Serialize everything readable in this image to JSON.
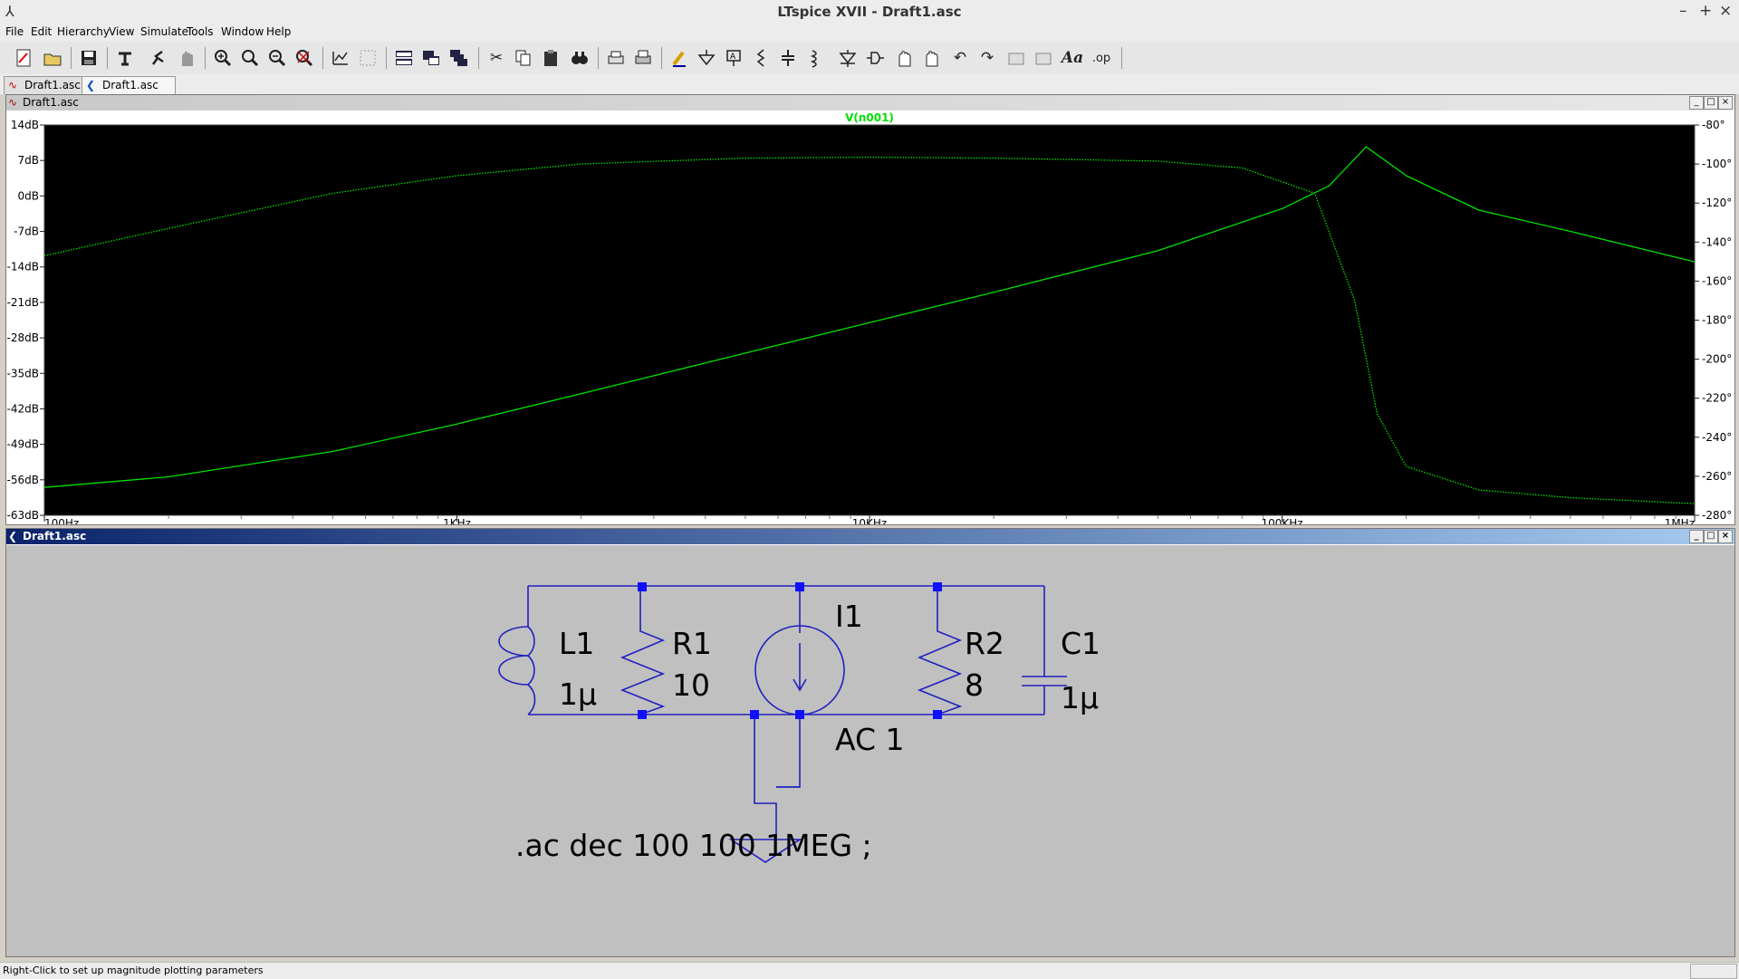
{
  "window": {
    "title": "LTspice XVII - Draft1.asc",
    "minimize": "–",
    "maximize": "+",
    "close": "×"
  },
  "menu": [
    "File",
    "Edit",
    "Hierarchy",
    "View",
    "Simulate",
    "Tools",
    "Window",
    "Help"
  ],
  "toolbar_icons": [
    "new-schematic-icon",
    "open-icon",
    "save-icon",
    "control-panel-icon",
    "run-icon",
    "halt-icon",
    "zoom-in-icon",
    "zoom-area-icon",
    "zoom-out-icon",
    "zoom-fit-icon",
    "autorange-icon",
    "plot-settings-icon",
    "tile-horizontal-icon",
    "tile-vertical-icon",
    "cascade-icon",
    "cut-icon",
    "copy-icon",
    "paste-icon",
    "find-icon",
    "print-icon",
    "print-setup-icon",
    "wire-icon",
    "ground-icon",
    "label-net-icon",
    "resistor-icon",
    "capacitor-icon",
    "inductor-icon",
    "diode-icon",
    "component-icon",
    "move-icon",
    "drag-icon",
    "undo-icon",
    "redo-icon",
    "rotate-icon",
    "mirror-icon",
    "text-icon",
    "spice-directive-icon"
  ],
  "tabs": [
    {
      "label": "Draft1.asc",
      "icon": "waveform-icon"
    },
    {
      "label": "Draft1.asc",
      "icon": "schematic-icon"
    }
  ],
  "plot_window": {
    "title": "Draft1.asc",
    "trace_label": "V(n001)",
    "trace_color": "#00e000",
    "background": "#000000"
  },
  "chart_data": {
    "type": "line",
    "title": "V(n001)",
    "x_scale": "log",
    "xlim": [
      100,
      1000000
    ],
    "x_tick_labels": [
      "100Hz",
      "1KHz",
      "10KHz",
      "100KHz",
      "1MHz"
    ],
    "y_left_ticks": [
      "14dB",
      "7dB",
      "0dB",
      "-7dB",
      "-14dB",
      "-21dB",
      "-28dB",
      "-35dB",
      "-42dB",
      "-49dB",
      "-56dB",
      "-63dB"
    ],
    "y_left_range_db": [
      -63,
      14
    ],
    "y_right_ticks": [
      "-80°",
      "-100°",
      "-120°",
      "-140°",
      "-160°",
      "-180°",
      "-200°",
      "-220°",
      "-240°",
      "-260°",
      "-280°"
    ],
    "y_right_range_deg": [
      -280,
      -80
    ],
    "series": [
      {
        "label": "magnitude",
        "axis": "left",
        "style": "solid",
        "x": [
          100,
          200,
          500,
          1000,
          2000,
          5000,
          10000,
          20000,
          50000,
          100000,
          130000,
          160000,
          200000,
          300000,
          500000,
          1000000
        ],
        "y": [
          -57.5,
          -55.4,
          -50.4,
          -45.0,
          -39.0,
          -31.0,
          -25.0,
          -19.0,
          -10.8,
          -2.5,
          2.0,
          9.7,
          4.0,
          -2.8,
          -7.0,
          -13.0
        ]
      },
      {
        "label": "phase",
        "axis": "right",
        "style": "dotted",
        "x": [
          100,
          200,
          500,
          1000,
          2000,
          5000,
          10000,
          20000,
          50000,
          80000,
          120000,
          150000,
          170000,
          200000,
          300000,
          500000,
          1000000
        ],
        "y": [
          -147,
          -133,
          -115,
          -106,
          -100,
          -97,
          -96.5,
          -97,
          -98.5,
          -102,
          -115,
          -170,
          -228,
          -255,
          -267,
          -271,
          -274
        ]
      }
    ]
  },
  "schematic_window": {
    "title": "Draft1.asc",
    "wire_color": "#2020c0",
    "junction_color": "#1010ff",
    "components": {
      "L1": {
        "name": "L1",
        "value": "1µ"
      },
      "R1": {
        "name": "R1",
        "value": "10"
      },
      "I1": {
        "name": "I1",
        "value": "AC 1"
      },
      "R2": {
        "name": "R2",
        "value": "8"
      },
      "C1": {
        "name": "C1",
        "value": "1µ"
      }
    },
    "directive": ".ac dec 100 100 1MEG ;"
  },
  "status": {
    "text": "Right-Click to set up magnitude plotting parameters"
  }
}
